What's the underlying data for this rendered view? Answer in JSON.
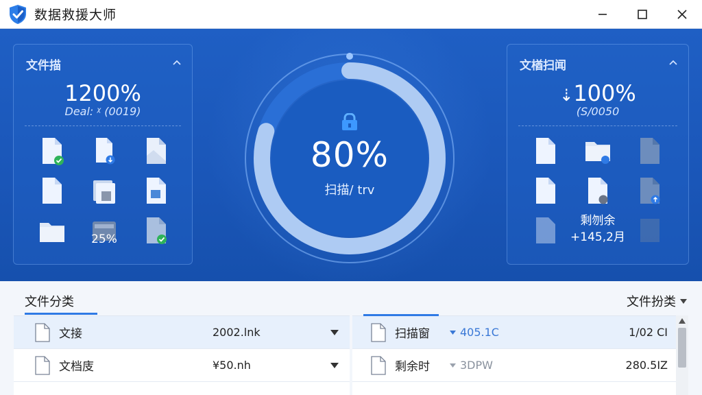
{
  "window": {
    "title": "数据救援大师"
  },
  "left_panel": {
    "title": "文件描",
    "big_value": "1200%",
    "sub_value": "Deal: ᵡ (0019)",
    "overlay_label": "25%"
  },
  "center": {
    "value": "80%",
    "label": "扫描/ trv",
    "progress": 0.8
  },
  "right_panel": {
    "title": "文楢扫闻",
    "big_value": "100%",
    "sub_value": "(S/0050",
    "overlay_line1": "剩刎余",
    "overlay_line2": "+145,2月"
  },
  "bottom": {
    "category_title": "文件分类",
    "sort_label": "文件扮类",
    "left_rows": [
      {
        "name": "文接",
        "size": "2002.lnk"
      },
      {
        "name": "文档庋",
        "size": "¥50.nh"
      }
    ],
    "right_rows": [
      {
        "name": "扫描窗",
        "mid": "405.1C",
        "value": "1/02 CI"
      },
      {
        "name": "剩余时",
        "mid": "3DPW",
        "value": "280.5IZ"
      }
    ]
  },
  "colors": {
    "accent": "#2f7ae5",
    "hero": "#1a56b8"
  }
}
